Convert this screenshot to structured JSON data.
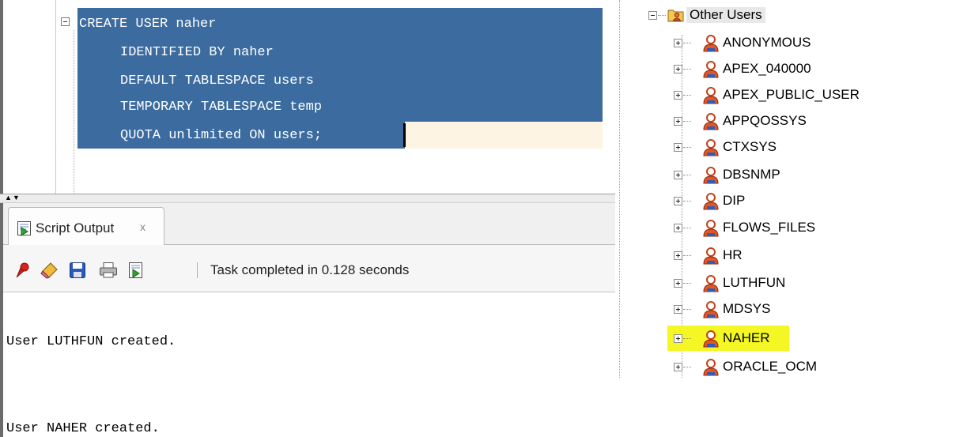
{
  "editor": {
    "code_lines": [
      "CREATE USER naher",
      "IDENTIFIED BY naher",
      "DEFAULT TABLESPACE users",
      "TEMPORARY TABLESPACE temp",
      "QUOTA unlimited ON users;"
    ]
  },
  "output_panel": {
    "tab_label": "Script Output",
    "tab_close": "x",
    "status_text": "Task completed in 0.128 seconds",
    "toolbar_icons": [
      "pin-icon",
      "eraser-icon",
      "save-icon",
      "print-icon",
      "run-script-icon"
    ],
    "lines": [
      "User LUTHFUN created.",
      "User NAHER created."
    ]
  },
  "connections": {
    "folder_label": "Other Users",
    "users": [
      "ANONYMOUS",
      "APEX_040000",
      "APEX_PUBLIC_USER",
      "APPQOSSYS",
      "CTXSYS",
      "DBSNMP",
      "DIP",
      "FLOWS_FILES",
      "HR",
      "LUTHFUN",
      "MDSYS",
      "NAHER",
      "ORACLE_OCM"
    ],
    "highlighted_user": "NAHER",
    "highlight_color": "#f4f724"
  },
  "colors": {
    "selection": "#3b6b9f",
    "current_line": "#fdf4e4"
  }
}
